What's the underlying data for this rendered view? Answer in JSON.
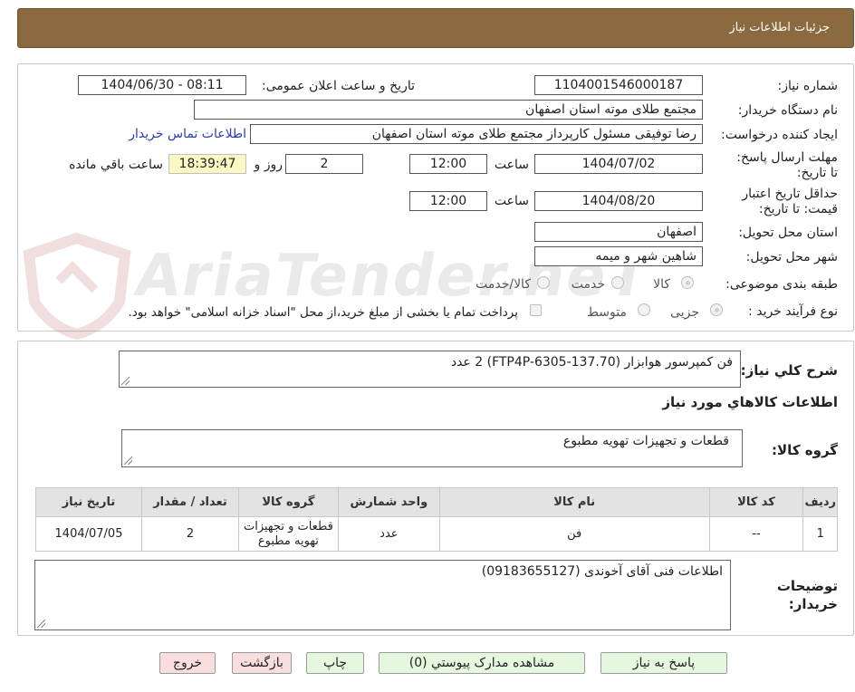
{
  "header": {
    "title": "جزئیات اطلاعات نیاز"
  },
  "form": {
    "need_number_label": "شماره نیاز:",
    "need_number": "1104001546000187",
    "announce_label": "تاریخ و ساعت اعلان عمومی:",
    "announce_value": "1404/06/30 - 08:11",
    "buyer_org_label": "نام دستگاه خریدار:",
    "buyer_org": "مجتمع طلای موته استان اصفهان",
    "requester_label": "ایجاد کننده درخواست:",
    "requester": "رضا توفیقی مسئول کارپرداز مجتمع طلای موته استان اصفهان",
    "contact_link": "اطلاعات تماس خریدار",
    "deadline_label": "مهلت ارسال پاسخ: تا تاریخ:",
    "deadline_date": "1404/07/02",
    "time_label": "ساعت",
    "deadline_time": "12:00",
    "days_value": "2",
    "days_label": "روز و",
    "remaining_time": "18:39:47",
    "remaining_label": "ساعت باقي مانده",
    "validity_label": "حداقل تاریخ اعتبار قیمت: تا تاریخ:",
    "validity_date": "1404/08/20",
    "validity_time": "12:00",
    "province_label": "استان محل تحویل:",
    "province": "اصفهان",
    "city_label": "شهر محل تحویل:",
    "city": "شاهین شهر و میمه",
    "category_label": "طبقه بندی موضوعی:",
    "category_options": [
      "کالا",
      "خدمت",
      "کالا/خدمت"
    ],
    "process_label": "نوع فرآیند خرید :",
    "process_options": [
      "جزیی",
      "متوسط"
    ],
    "payment_note": "پرداخت تمام یا بخشی از مبلغ خرید،از محل \"اسناد خزانه اسلامی\" خواهد بود."
  },
  "description": {
    "label": "شرح کلي نياز:",
    "value": "فن کمپرسور هوابزار (FTP4P-6305-137.70)  2 عدد"
  },
  "goods_info": {
    "heading": "اطلاعات کالاهاي مورد نياز",
    "group_label": "گروه کالا:",
    "group_value": "قطعات و تجهیزات تهویه مطبوع"
  },
  "table": {
    "headers": [
      "رديف",
      "کد کالا",
      "نام کالا",
      "واحد شمارش",
      "گروه کالا",
      "تعداد / مقدار",
      "تاريخ نياز"
    ],
    "rows": [
      [
        "1",
        "--",
        "فن",
        "عدد",
        "قطعات و تجهیزات تهویه مطبوع",
        "2",
        "1404/07/05"
      ]
    ]
  },
  "buyer_notes": {
    "label": "توضیحات خریدار:",
    "value": "اطلاعات فنی آقای آخوندی (09183655127)"
  },
  "buttons": {
    "reply": "پاسخ به نياز",
    "attachments": "مشاهده مدارک پيوستي (0)",
    "print": "چاپ",
    "back": "بازگشت",
    "exit": "خروج"
  },
  "watermark": "AriaTender.neT"
}
